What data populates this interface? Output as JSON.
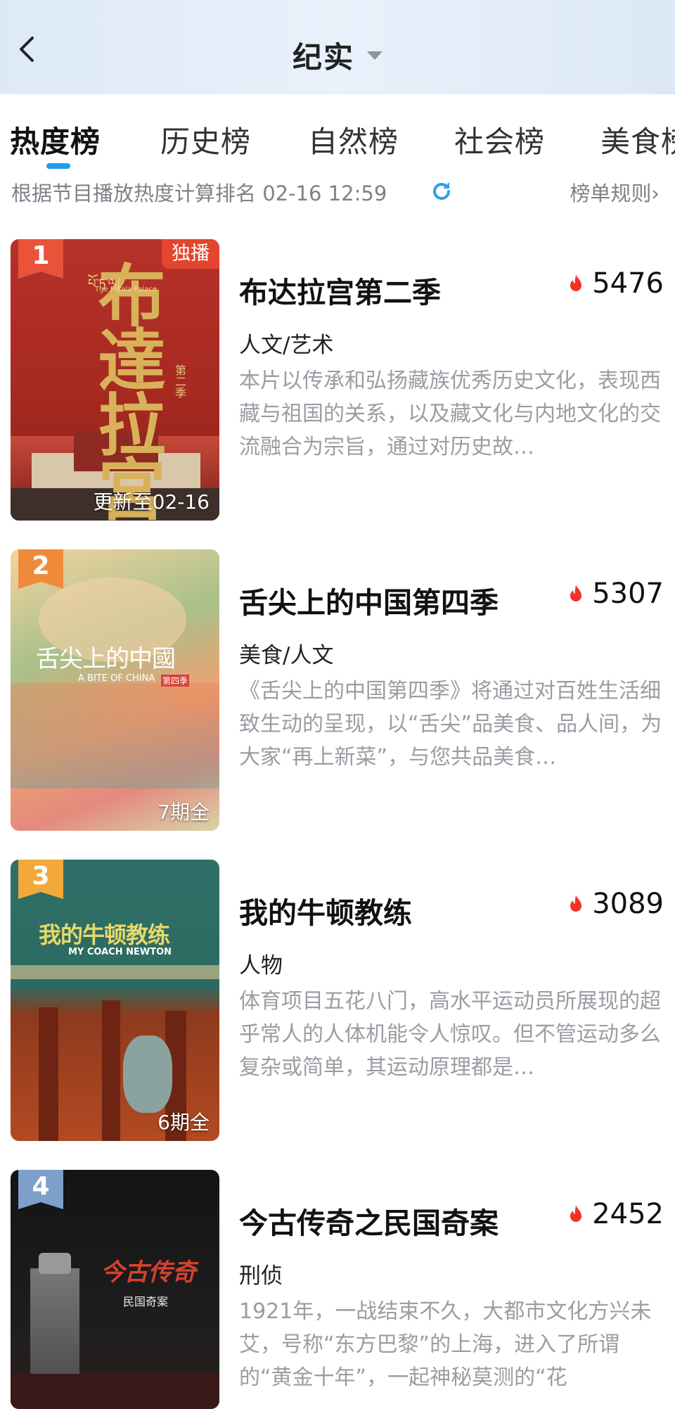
{
  "header": {
    "title": "纪实",
    "back_icon": "chevron-left-icon",
    "title_dropdown_icon": "caret-down-icon",
    "background": "#e3edf9"
  },
  "tabs": [
    {
      "label": "热度榜",
      "active": true
    },
    {
      "label": "历史榜",
      "active": false
    },
    {
      "label": "自然榜",
      "active": false
    },
    {
      "label": "社会榜",
      "active": false
    },
    {
      "label": "美食榜",
      "active": false
    }
  ],
  "accent_color": "#1f9cf0",
  "subheader": {
    "ranking_note": "根据节目播放热度计算排名 02-16 12:59",
    "refresh_icon": "refresh-icon",
    "rules_link": "榜单规则›"
  },
  "items": [
    {
      "rank": "1",
      "rank_color": "#e8533a",
      "title": "布达拉宫第二季",
      "heat": "5476",
      "heat_icon": "flame-icon",
      "genre": "人文/艺术",
      "description": "本片以传承和弘扬藏族优秀历史文化，表现西藏与祖国的关系，以及藏文化与内地文化的交流融合为宗旨，通过对历史故…",
      "badge": "独播",
      "poster_footer": "更新至02-16",
      "poster_text": "布達拉宮",
      "poster_small_text": "The Potala Palace",
      "poster_tibetan": "པོ་ཏ་ལ།",
      "poster_season": "第二季"
    },
    {
      "rank": "2",
      "rank_color": "#f08a3b",
      "title": "舌尖上的中国第四季",
      "heat": "5307",
      "heat_icon": "flame-icon",
      "genre": "美食/人文",
      "description": "《舌尖上的中国第四季》将通过对百姓生活细致生动的呈现，以“舌尖”品美食、品人间，为大家“再上新菜”，与您共品美食…",
      "badge": "",
      "poster_footer": "7期全",
      "poster_text": "舌尖上的中國",
      "poster_small_text": "A BITE OF CHINA",
      "poster_season": "第四季"
    },
    {
      "rank": "3",
      "rank_color": "#f2a93a",
      "title": "我的牛顿教练",
      "heat": "3089",
      "heat_icon": "flame-icon",
      "genre": "人物",
      "description": "体育项目五花八门，高水平运动员所展现的超乎常人的人体机能令人惊叹。但不管运动多么复杂或简单，其运动原理都是…",
      "badge": "",
      "poster_footer": "6期全",
      "poster_text": "我的牛顿教练",
      "poster_small_text": "MY COACH NEWTON"
    },
    {
      "rank": "4",
      "rank_color": "#7d9fc9",
      "title": "今古传奇之民国奇案",
      "heat": "2452",
      "heat_icon": "flame-icon",
      "genre": "刑侦",
      "description": "1921年，一战结束不久，大都市文化方兴未艾，号称“东方巴黎”的上海，进入了所谓的“黄金十年”，一起神秘莫测的“花",
      "badge": "",
      "poster_footer": "",
      "poster_text": "今古传奇",
      "poster_small_text": "民国奇案"
    }
  ]
}
